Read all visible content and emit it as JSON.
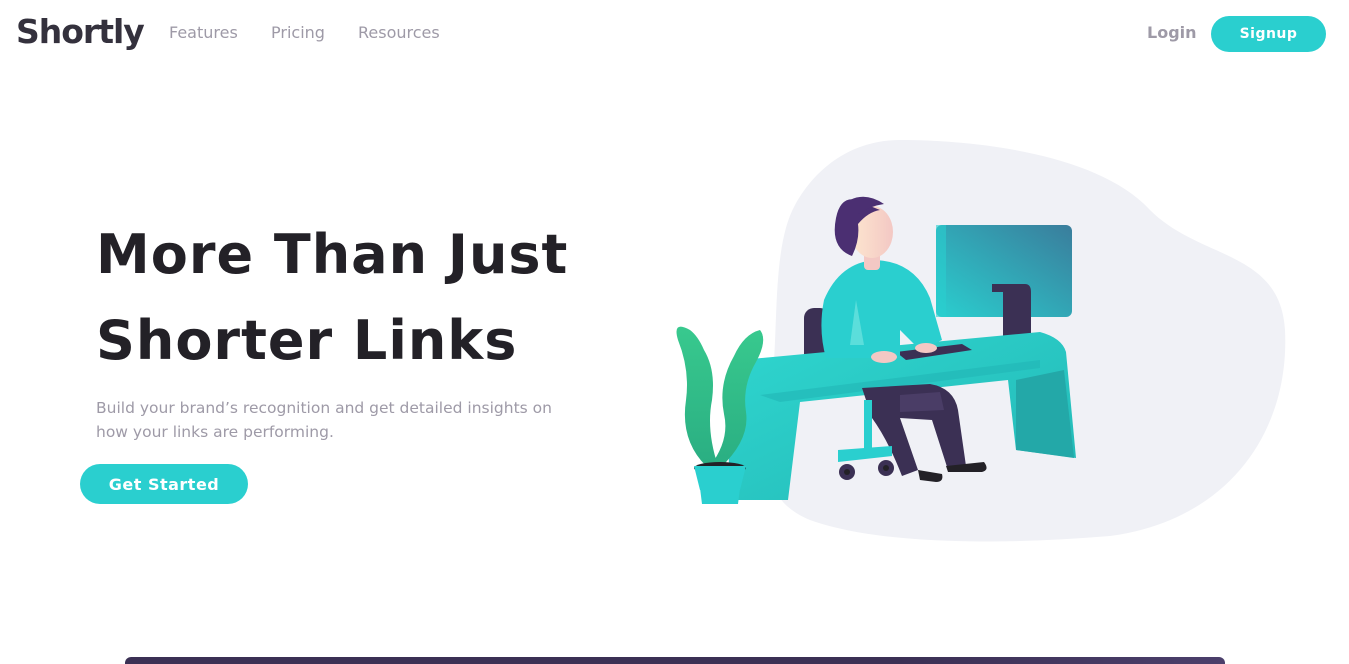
{
  "header": {
    "logo": "Shortly",
    "nav": [
      "Features",
      "Pricing",
      "Resources"
    ],
    "login_label": "Login",
    "signup_label": "Signup"
  },
  "hero": {
    "title_line1": "More Than Just",
    "title_line2": "Shorter Links",
    "subtitle": "Build your brand’s recognition and get detailed insights on how your links are performing.",
    "cta_label": "Get Started"
  },
  "icons": [
    "working-illustration"
  ],
  "colors": {
    "primary_cyan": "#2acfcf",
    "dark_violet": "#3b3054",
    "very_dark_text": "#232127",
    "gray_text": "#9e9aa7",
    "illustration_bg": "#f0f1f6"
  }
}
